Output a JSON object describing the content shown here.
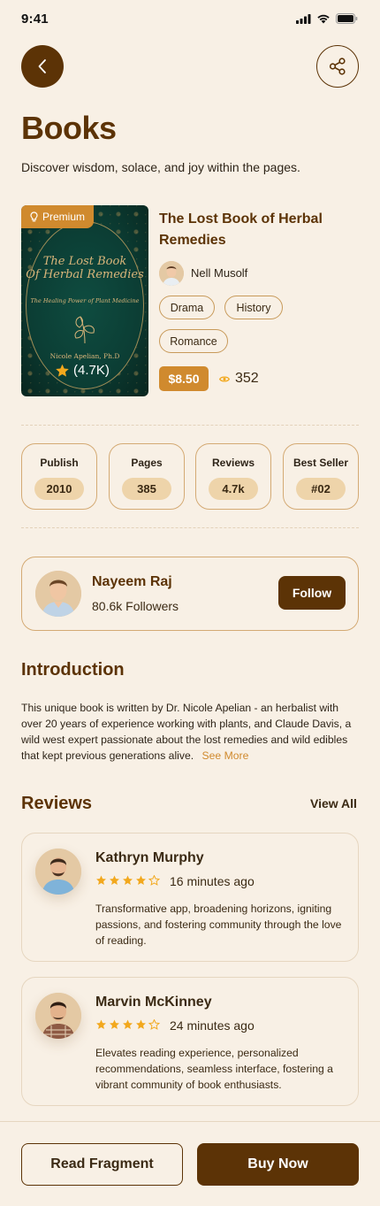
{
  "status_bar": {
    "time": "9:41"
  },
  "header": {
    "title": "Books",
    "subtitle": "Discover wisdom, solace, and joy within the pages."
  },
  "book": {
    "premium_label": "Premium",
    "cover": {
      "title_line1": "The Lost Book",
      "title_line2": "Of Herbal Remedies",
      "subtitle": "The Healing Power of Plant Medicine",
      "author": "Nicole Apelian, Ph.D",
      "rating": "(4.7K)"
    },
    "title": "The Lost Book of Herbal Remedies",
    "author": "Nell Musolf",
    "tags": [
      "Drama",
      "History",
      "Romance"
    ],
    "price": "$8.50",
    "views": "352"
  },
  "stats": [
    {
      "label": "Publish",
      "value": "2010"
    },
    {
      "label": "Pages",
      "value": "385"
    },
    {
      "label": "Reviews",
      "value": "4.7k"
    },
    {
      "label": "Best Seller",
      "value": "#02"
    }
  ],
  "publisher": {
    "name": "Nayeem Raj",
    "followers": "80.6k Followers",
    "follow_label": "Follow"
  },
  "introduction": {
    "title": "Introduction",
    "text": "This unique book is written by Dr. Nicole Apelian - an herbalist with over 20 years of experience working with plants, and Claude Davis, a wild west expert passionate about the lost remedies and wild edibles that kept previous generations alive.",
    "see_more": "See More"
  },
  "reviews": {
    "title": "Reviews",
    "view_all": "View All",
    "items": [
      {
        "name": "Kathryn Murphy",
        "stars": 4,
        "time": "16 minutes ago",
        "text": "Transformative app, broadening horizons, igniting passions, and fostering community through the love of reading."
      },
      {
        "name": "Marvin McKinney",
        "stars": 4,
        "time": "24 minutes ago",
        "text": "Elevates reading experience, personalized recommendations, seamless interface, fostering a vibrant community of book enthusiasts."
      }
    ]
  },
  "actions": {
    "read_fragment": "Read Fragment",
    "buy_now": "Buy Now"
  },
  "colors": {
    "primary": "#5C3306",
    "accent": "#D08A2E",
    "background": "#F8F0E5",
    "star": "#F2A81D"
  }
}
